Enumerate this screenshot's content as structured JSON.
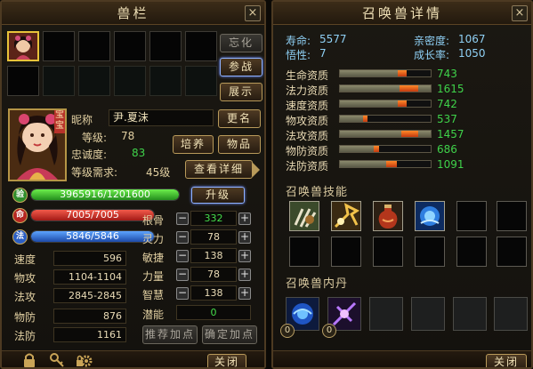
{
  "left": {
    "title": "兽栏",
    "close_label": "×",
    "side_buttons": {
      "stop": "忘化",
      "battle": "参战",
      "show": "展示"
    },
    "pet": {
      "name_label": "昵称",
      "name": "尹.夏沫",
      "rename": "更名",
      "level_label": "等级:",
      "level": "78",
      "loyalty_label": "忠诚度:",
      "loyalty": "83",
      "req_label": "等级需求:",
      "req": "45级",
      "train": "培养",
      "items": "物品",
      "detail": "查看详细",
      "portrait_tag": "宝宝"
    },
    "exp": {
      "icon": "验",
      "text": "3965916/1201600",
      "fill": 1.0
    },
    "hp": {
      "icon": "命",
      "text": "7005/7005",
      "fill": 1.0
    },
    "mp": {
      "icon": "法",
      "text": "5846/5846",
      "fill": 1.0
    },
    "upgrade": "升级",
    "stats": [
      {
        "label": "速度",
        "value": "596"
      },
      {
        "label": "物攻",
        "value": "1104-1104"
      },
      {
        "label": "法攻",
        "value": "2845-2845"
      },
      {
        "label": "物防",
        "value": "876"
      },
      {
        "label": "法防",
        "value": "1161"
      }
    ],
    "attrs": [
      {
        "label": "根骨",
        "value": "332",
        "accent": "#44dd4a"
      },
      {
        "label": "灵力",
        "value": "78",
        "accent": "#eadcb7"
      },
      {
        "label": "敏捷",
        "value": "138",
        "accent": "#eadcb7"
      },
      {
        "label": "力量",
        "value": "78",
        "accent": "#eadcb7"
      },
      {
        "label": "智慧",
        "value": "138",
        "accent": "#eadcb7"
      }
    ],
    "potential_label": "潜能",
    "potential": "0",
    "recommend": "推荐加点",
    "confirm": "确定加点",
    "footer_close": "关闭"
  },
  "right": {
    "title": "召唤兽详情",
    "close_label": "×",
    "info": [
      {
        "label": "寿命:",
        "value": "5577"
      },
      {
        "label": "亲密度:",
        "value": "1067"
      },
      {
        "label": "悟性:",
        "value": "7"
      },
      {
        "label": "成长率:",
        "value": "1050"
      }
    ],
    "aptitudes": [
      {
        "label": "生命资质",
        "value": "743",
        "fill": 0.74,
        "mark": 0.1
      },
      {
        "label": "法力资质",
        "value": "1615",
        "fill": 1.0,
        "mark_at": 0.66,
        "mark": 0.2
      },
      {
        "label": "速度资质",
        "value": "742",
        "fill": 0.74,
        "mark": 0.1
      },
      {
        "label": "物攻资质",
        "value": "537",
        "fill": 0.3,
        "mark": 0.05
      },
      {
        "label": "法攻资质",
        "value": "1457",
        "fill": 1.0,
        "mark_at": 0.68,
        "mark": 0.18
      },
      {
        "label": "物防资质",
        "value": "686",
        "fill": 0.43,
        "mark": 0.06
      },
      {
        "label": "法防资质",
        "value": "1091",
        "fill": 0.63,
        "mark": 0.12
      }
    ],
    "skills_title": "召唤兽技能",
    "neidan_title": "召唤兽内丹",
    "neidan_badges": [
      "0",
      "0"
    ],
    "footer_close": "关闭",
    "colors": {
      "aptitude_value": "#3fd24a",
      "mark": "#e4531a"
    }
  }
}
